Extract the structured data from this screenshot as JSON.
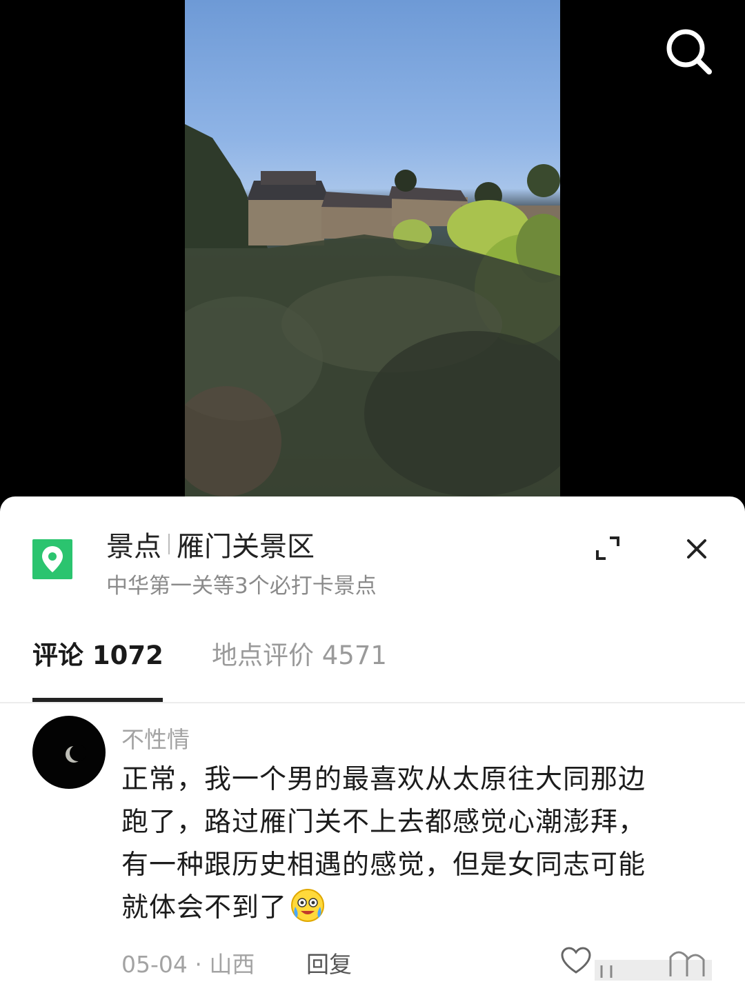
{
  "poi": {
    "category": "景点",
    "name": "雁门关景区",
    "subtitle": "中华第一关等3个必打卡景点"
  },
  "tabs": [
    {
      "label": "评论 1072",
      "active": true
    },
    {
      "label": "地点评价 4571",
      "active": false
    }
  ],
  "comment": {
    "username": "不性情",
    "lines": [
      "正常，我一个男的最喜欢从太原往大同那边",
      "跑了，路过雁门关不上去都感觉心潮澎拜，",
      "有一种跟历史相遇的感觉，但是女同志可能",
      "就体会不到了"
    ],
    "emoji": "crying-laughing-emoji",
    "date": "05-04",
    "location": "山西",
    "meta_separator": " · ",
    "reply_label": "回复"
  },
  "colors": {
    "accent_green": "#2bc46f",
    "sheet_bg": "#ffffff",
    "video_bg": "#000000"
  }
}
